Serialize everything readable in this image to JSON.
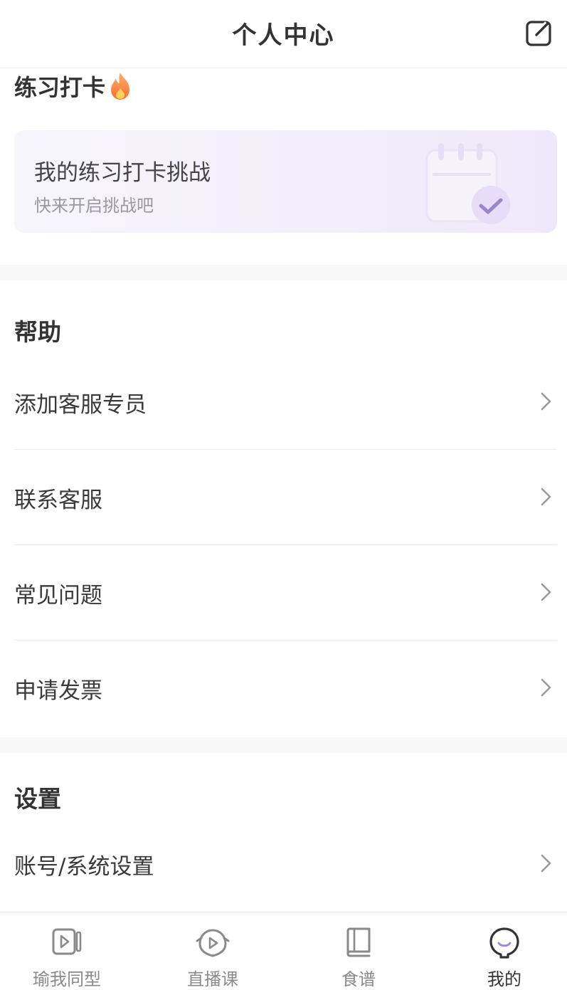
{
  "header": {
    "title": "个人中心",
    "edit_icon": "edit-icon"
  },
  "checkin": {
    "title": "练习打卡",
    "icon": "fire-icon",
    "card": {
      "title": "我的练习打卡挑战",
      "subtitle": "快来开启挑战吧",
      "icon": "calendar-check-icon"
    }
  },
  "help": {
    "title": "帮助",
    "items": [
      {
        "label": "添加客服专员"
      },
      {
        "label": "联系客服"
      },
      {
        "label": "常见问题"
      },
      {
        "label": "申请发票"
      }
    ]
  },
  "settings": {
    "title": "设置",
    "items": [
      {
        "label": "账号/系统设置"
      }
    ]
  },
  "tabbar": {
    "active_color": "#333333",
    "inactive_color": "#8a8a8a",
    "tabs": [
      {
        "label": "瑜我同型",
        "icon": "video-icon"
      },
      {
        "label": "直播课",
        "icon": "live-play-icon"
      },
      {
        "label": "食谱",
        "icon": "book-icon"
      },
      {
        "label": "我的",
        "icon": "face-icon",
        "active": true
      }
    ]
  },
  "colors": {
    "card_bg": "#f2eefa",
    "accent": "#9b86c9",
    "divider": "#f8f8f8"
  }
}
